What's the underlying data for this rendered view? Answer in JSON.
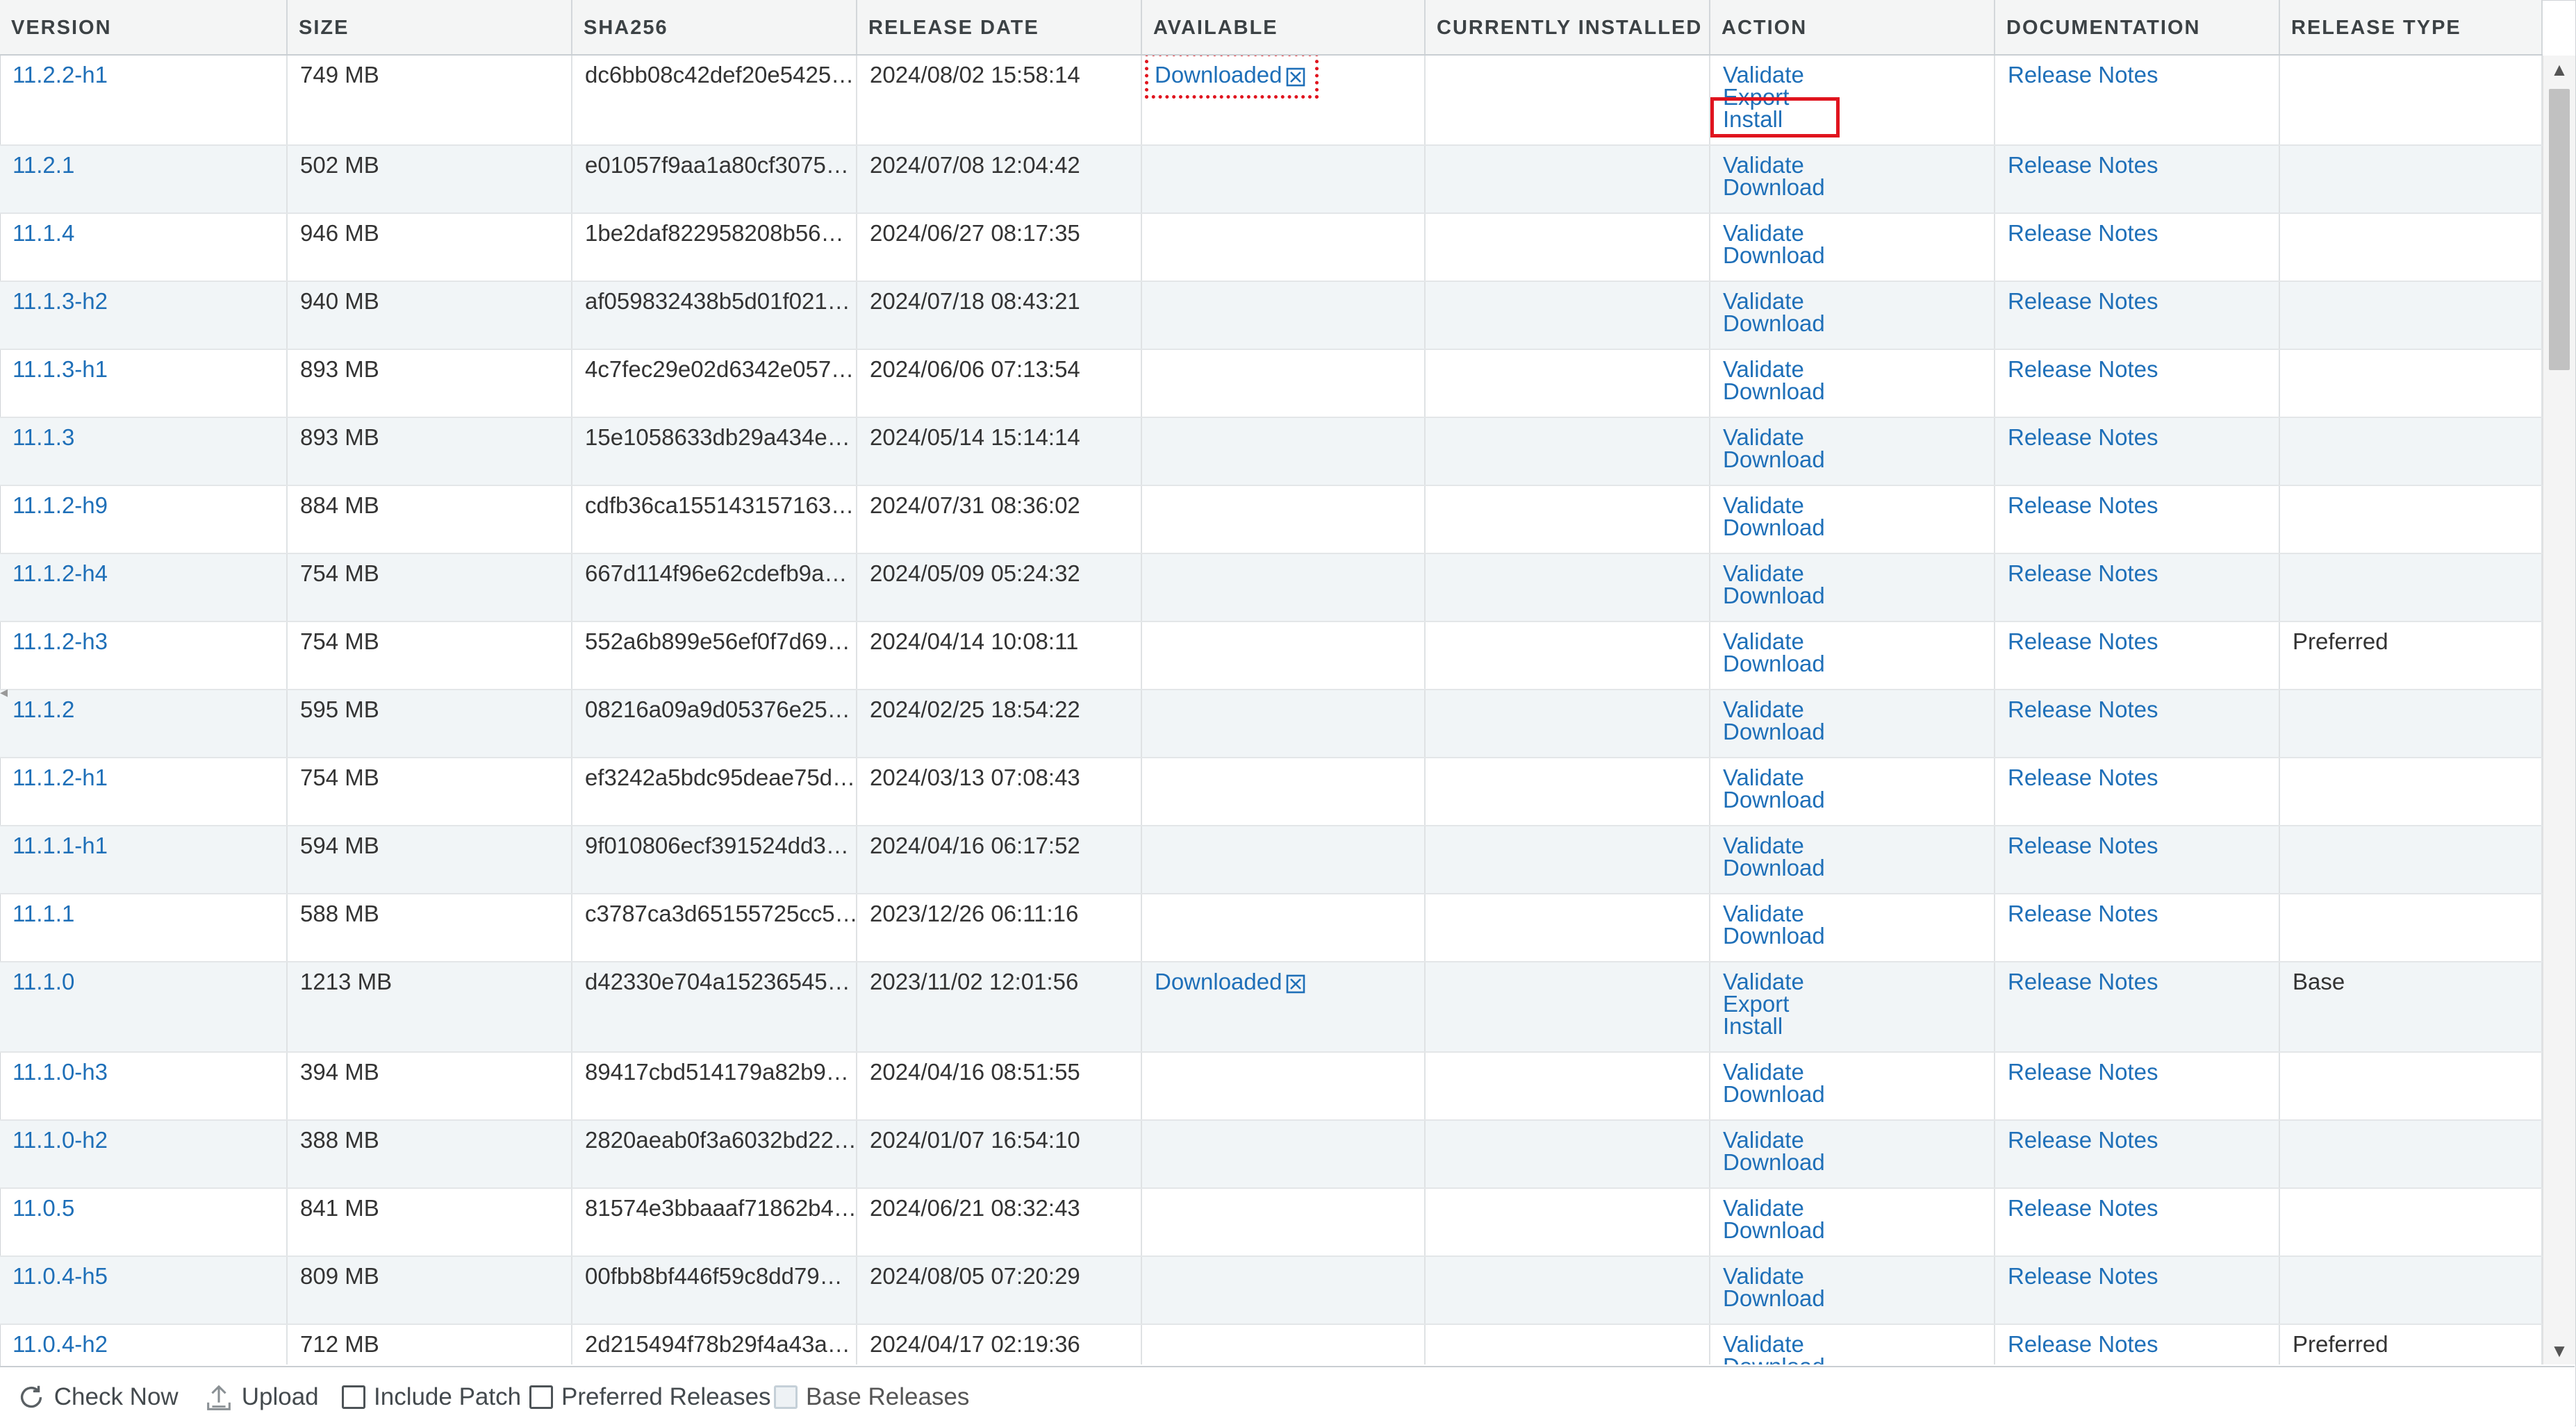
{
  "columns": [
    "VERSION",
    "SIZE",
    "SHA256",
    "RELEASE DATE",
    "AVAILABLE",
    "CURRENTLY INSTALLED",
    "ACTION",
    "DOCUMENTATION",
    "RELEASE TYPE"
  ],
  "rows": [
    {
      "version": "11.2.2-h1",
      "size": "749 MB",
      "sha": "dc6bb08c42def20e5425…",
      "date": "2024/08/02 15:58:14",
      "available": "Downloaded",
      "installed": "",
      "actions": [
        "Validate",
        "Export",
        "Install"
      ],
      "doc": "Release Notes",
      "type": ""
    },
    {
      "version": "11.2.1",
      "size": "502 MB",
      "sha": "e01057f9aa1a80cf3075…",
      "date": "2024/07/08 12:04:42",
      "available": "",
      "installed": "",
      "actions": [
        "Validate",
        "Download"
      ],
      "doc": "Release Notes",
      "type": ""
    },
    {
      "version": "11.1.4",
      "size": "946 MB",
      "sha": "1be2daf822958208b56…",
      "date": "2024/06/27 08:17:35",
      "available": "",
      "installed": "",
      "actions": [
        "Validate",
        "Download"
      ],
      "doc": "Release Notes",
      "type": ""
    },
    {
      "version": "11.1.3-h2",
      "size": "940 MB",
      "sha": "af059832438b5d01f021…",
      "date": "2024/07/18 08:43:21",
      "available": "",
      "installed": "",
      "actions": [
        "Validate",
        "Download"
      ],
      "doc": "Release Notes",
      "type": ""
    },
    {
      "version": "11.1.3-h1",
      "size": "893 MB",
      "sha": "4c7fec29e02d6342e057…",
      "date": "2024/06/06 07:13:54",
      "available": "",
      "installed": "",
      "actions": [
        "Validate",
        "Download"
      ],
      "doc": "Release Notes",
      "type": ""
    },
    {
      "version": "11.1.3",
      "size": "893 MB",
      "sha": "15e1058633db29a434e…",
      "date": "2024/05/14 15:14:14",
      "available": "",
      "installed": "",
      "actions": [
        "Validate",
        "Download"
      ],
      "doc": "Release Notes",
      "type": ""
    },
    {
      "version": "11.1.2-h9",
      "size": "884 MB",
      "sha": "cdfb36ca155143157163…",
      "date": "2024/07/31 08:36:02",
      "available": "",
      "installed": "",
      "actions": [
        "Validate",
        "Download"
      ],
      "doc": "Release Notes",
      "type": ""
    },
    {
      "version": "11.1.2-h4",
      "size": "754 MB",
      "sha": "667d114f96e62cdefb9a…",
      "date": "2024/05/09 05:24:32",
      "available": "",
      "installed": "",
      "actions": [
        "Validate",
        "Download"
      ],
      "doc": "Release Notes",
      "type": ""
    },
    {
      "version": "11.1.2-h3",
      "size": "754 MB",
      "sha": "552a6b899e56ef0f7d69…",
      "date": "2024/04/14 10:08:11",
      "available": "",
      "installed": "",
      "actions": [
        "Validate",
        "Download"
      ],
      "doc": "Release Notes",
      "type": "Preferred"
    },
    {
      "version": "11.1.2",
      "size": "595 MB",
      "sha": "08216a09a9d05376e25…",
      "date": "2024/02/25 18:54:22",
      "available": "",
      "installed": "",
      "actions": [
        "Validate",
        "Download"
      ],
      "doc": "Release Notes",
      "type": ""
    },
    {
      "version": "11.1.2-h1",
      "size": "754 MB",
      "sha": "ef3242a5bdc95deae75d…",
      "date": "2024/03/13 07:08:43",
      "available": "",
      "installed": "",
      "actions": [
        "Validate",
        "Download"
      ],
      "doc": "Release Notes",
      "type": ""
    },
    {
      "version": "11.1.1-h1",
      "size": "594 MB",
      "sha": "9f010806ecf391524dd3…",
      "date": "2024/04/16 06:17:52",
      "available": "",
      "installed": "",
      "actions": [
        "Validate",
        "Download"
      ],
      "doc": "Release Notes",
      "type": ""
    },
    {
      "version": "11.1.1",
      "size": "588 MB",
      "sha": "c3787ca3d65155725cc5…",
      "date": "2023/12/26 06:11:16",
      "available": "",
      "installed": "",
      "actions": [
        "Validate",
        "Download"
      ],
      "doc": "Release Notes",
      "type": ""
    },
    {
      "version": "11.1.0",
      "size": "1213 MB",
      "sha": "d42330e704a15236545…",
      "date": "2023/11/02 12:01:56",
      "available": "Downloaded",
      "installed": "",
      "actions": [
        "Validate",
        "Export",
        "Install"
      ],
      "doc": "Release Notes",
      "type": "Base"
    },
    {
      "version": "11.1.0-h3",
      "size": "394 MB",
      "sha": "89417cbd514179a82b9…",
      "date": "2024/04/16 08:51:55",
      "available": "",
      "installed": "",
      "actions": [
        "Validate",
        "Download"
      ],
      "doc": "Release Notes",
      "type": ""
    },
    {
      "version": "11.1.0-h2",
      "size": "388 MB",
      "sha": "2820aeab0f3a6032bd22…",
      "date": "2024/01/07 16:54:10",
      "available": "",
      "installed": "",
      "actions": [
        "Validate",
        "Download"
      ],
      "doc": "Release Notes",
      "type": ""
    },
    {
      "version": "11.0.5",
      "size": "841 MB",
      "sha": "81574e3bbaaaf71862b4…",
      "date": "2024/06/21 08:32:43",
      "available": "",
      "installed": "",
      "actions": [
        "Validate",
        "Download"
      ],
      "doc": "Release Notes",
      "type": ""
    },
    {
      "version": "11.0.4-h5",
      "size": "809 MB",
      "sha": "00fbb8bf446f59c8dd79…",
      "date": "2024/08/05 07:20:29",
      "available": "",
      "installed": "",
      "actions": [
        "Validate",
        "Download"
      ],
      "doc": "Release Notes",
      "type": ""
    },
    {
      "version": "11.0.4-h2",
      "size": "712 MB",
      "sha": "2d215494f78b29f4a43a…",
      "date": "2024/04/17 02:19:36",
      "available": "",
      "installed": "",
      "actions": [
        "Validate",
        "Download"
      ],
      "doc": "Release Notes",
      "type": "Preferred"
    }
  ],
  "footer": {
    "check_now": "Check Now",
    "upload": "Upload",
    "include_patch": "Include Patch",
    "preferred_releases": "Preferred Releases",
    "base_releases": "Base Releases"
  },
  "icons": {
    "check_now": "refresh-icon",
    "upload": "upload-icon",
    "remove_download": "remove-download-icon"
  },
  "colors": {
    "link": "#1e6fb8",
    "row_alt": "#f1f5f7",
    "header_bg": "#f4f5f5",
    "highlight": "#e0141e"
  }
}
